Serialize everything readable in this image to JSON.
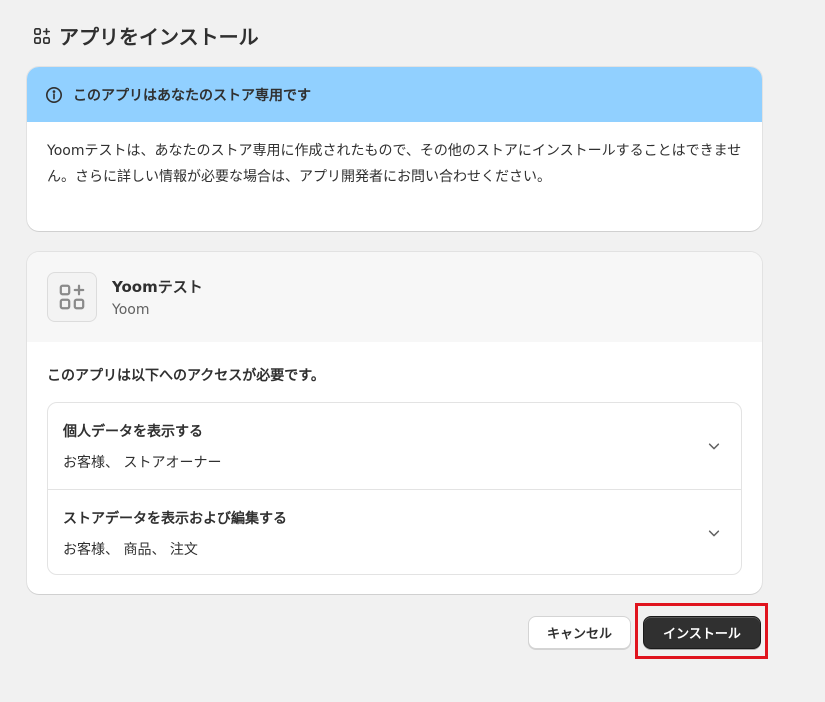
{
  "header": {
    "title": "アプリをインストール"
  },
  "banner": {
    "title": "このアプリはあなたのストア専用です",
    "body": "Yoomテストは、あなたのストア専用に作成されたもので、その他のストアにインストールすることはできません。さらに詳しい情報が必要な場合は、アプリ開発者にお問い合わせください。"
  },
  "app": {
    "name": "Yoomテスト",
    "developer": "Yoom",
    "access_heading": "このアプリは以下へのアクセスが必要です。",
    "permissions": [
      {
        "title": "個人データを表示する",
        "detail": "お客様、 ストアオーナー"
      },
      {
        "title": "ストアデータを表示および編集する",
        "detail": "お客様、 商品、 注文"
      }
    ]
  },
  "actions": {
    "cancel_label": "キャンセル",
    "install_label": "インストール"
  },
  "colors": {
    "banner_bg": "#91d0ff",
    "primary_button": "#303030",
    "highlight": "#e0141e",
    "page_bg": "#f1f1f1"
  },
  "icons": {
    "header": "apps-icon",
    "banner": "info-icon",
    "app_thumb": "app-placeholder-icon",
    "expand": "chevron-down-icon"
  }
}
